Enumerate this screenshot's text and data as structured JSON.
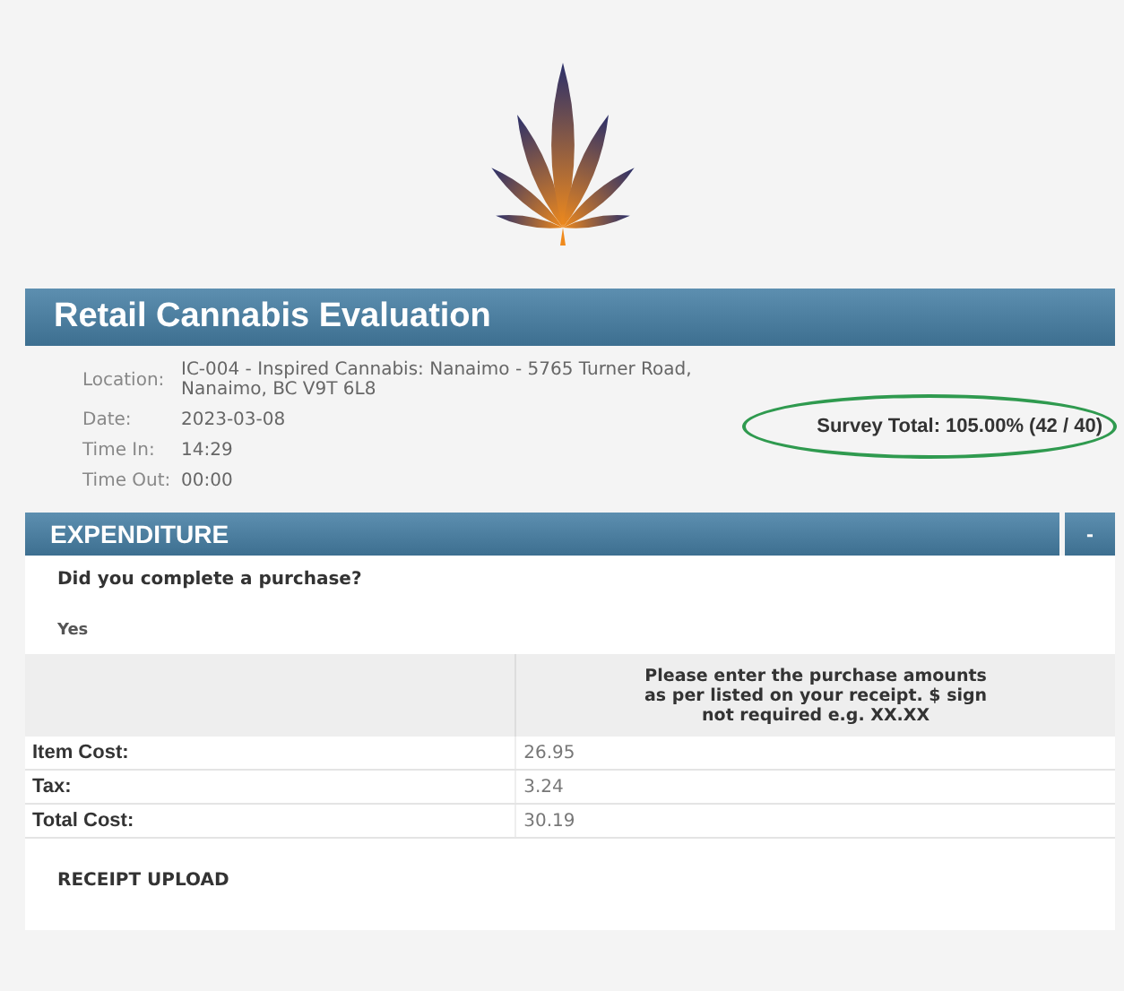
{
  "header": {
    "title": "Retail Cannabis Evaluation"
  },
  "info": [
    {
      "label": "Location:",
      "value": "IC-004 - Inspired Cannabis: Nanaimo - 5765 Turner Road, Nanaimo, BC V9T 6L8"
    },
    {
      "label": "Date:",
      "value": "2023-03-08"
    },
    {
      "label": "Time In:",
      "value": "14:29"
    },
    {
      "label": "Time Out:",
      "value": "00:00"
    }
  ],
  "survey_total": "Survey Total: 105.00% (42 / 40)",
  "section": {
    "title": "EXPENDITURE",
    "collapse_button": "-",
    "question": "Did you complete a purchase?",
    "answer": "Yes",
    "table": {
      "header": "Please enter the purchase amounts as per listed on your receipt. $ sign not required e.g. XX.XX",
      "rows": [
        {
          "label": "Item Cost:",
          "value": "26.95"
        },
        {
          "label": "Tax:",
          "value": "3.24"
        },
        {
          "label": "Total Cost:",
          "value": "30.19"
        }
      ]
    },
    "upload_label": "RECEIPT UPLOAD"
  }
}
